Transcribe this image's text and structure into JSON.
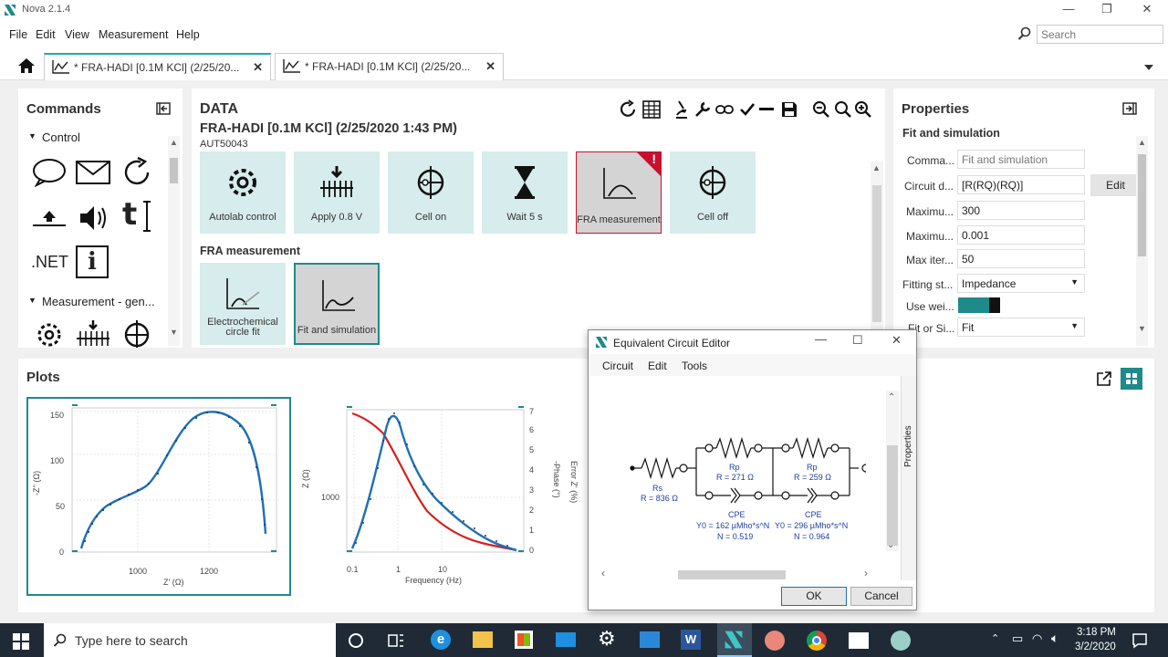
{
  "window": {
    "title": "Nova 2.1.4"
  },
  "menus": [
    "File",
    "Edit",
    "View",
    "Measurement",
    "Help"
  ],
  "search": {
    "placeholder": "Search"
  },
  "tabs": [
    {
      "label": "* FRA-HADI [0.1M KCl] (2/25/20..."
    },
    {
      "label": "* FRA-HADI [0.1M KCl] (2/25/20..."
    }
  ],
  "commands": {
    "title": "Commands",
    "group_control": "Control",
    "net_label": ".NET",
    "group_measurement": "Measurement - gen..."
  },
  "data": {
    "title": "DATA",
    "procedure": "FRA-HADI [0.1M KCl] (2/25/2020 1:43 PM)",
    "instrument": "AUT50043",
    "tiles": [
      "Autolab control",
      "Apply 0.8 V",
      "Cell on",
      "Wait 5 s",
      "FRA measurement",
      "Cell off"
    ],
    "subsection": "FRA measurement",
    "sub_tiles": [
      "Electrochemical circle fit",
      "Fit and simulation"
    ],
    "alert": "!"
  },
  "properties": {
    "title": "Properties",
    "subtitle": "Fit and simulation",
    "rows": [
      {
        "label": "Comma...",
        "value": "Fit and simulation"
      },
      {
        "label": "Circuit d...",
        "value": "[R(RQ)(RQ)]"
      },
      {
        "label": "Maximu...",
        "value": "300"
      },
      {
        "label": "Maximu...",
        "value": "0.001"
      },
      {
        "label": "Max iter...",
        "value": "50"
      },
      {
        "label": "Fitting st...",
        "value": "Impedance"
      },
      {
        "label": "Use wei...",
        "value": ""
      },
      {
        "label": "Fit or Si...",
        "value": "Fit"
      }
    ],
    "edit_button": "Edit"
  },
  "plots": {
    "title": "Plots",
    "nyquist": {
      "xlabel": "Z' (Ω)",
      "ylabel": "-Z'' (Ω)",
      "xticks": [
        "1000",
        "1200"
      ],
      "yticks": [
        "0",
        "50",
        "100",
        "150"
      ]
    },
    "bode": {
      "xlabel": "Frequency (Hz)",
      "ylabel": "Z (Ω)",
      "y2label": "-Phase (°)",
      "y3label": "Error Z' (%)",
      "xticks": [
        "0.1",
        "1",
        "10"
      ],
      "ytick": "1000",
      "y2ticks": [
        "0",
        "1",
        "2",
        "3",
        "4",
        "5",
        "6",
        "7"
      ]
    }
  },
  "dialog": {
    "title": "Equivalent Circuit Editor",
    "menus": [
      "Circuit",
      "Edit",
      "Tools"
    ],
    "side_tab": "Properties",
    "ok": "OK",
    "cancel": "Cancel",
    "circuit": {
      "rs_name": "Rs",
      "rs_value": "R = 836 Ω",
      "rp1_name": "Rp",
      "rp1_value": "R = 271 Ω",
      "rp2_name": "Rp",
      "rp2_value": "R = 259 Ω",
      "cpe1_name": "CPE",
      "cpe1_y0": "Y0 = 162 µMho*s^N",
      "cpe1_n": "N = 0.519",
      "cpe2_name": "CPE",
      "cpe2_y0": "Y0 = 296 µMho*s^N",
      "cpe2_n": "N = 0.964"
    }
  },
  "taskbar": {
    "search_placeholder": "Type here to search",
    "time": "3:18 PM",
    "date": "3/2/2020"
  },
  "colors": {
    "accent": "#1e8a8a",
    "tile": "#d7ecec",
    "fit_line": "#1f6fb5",
    "phase_line": "#d42020"
  }
}
